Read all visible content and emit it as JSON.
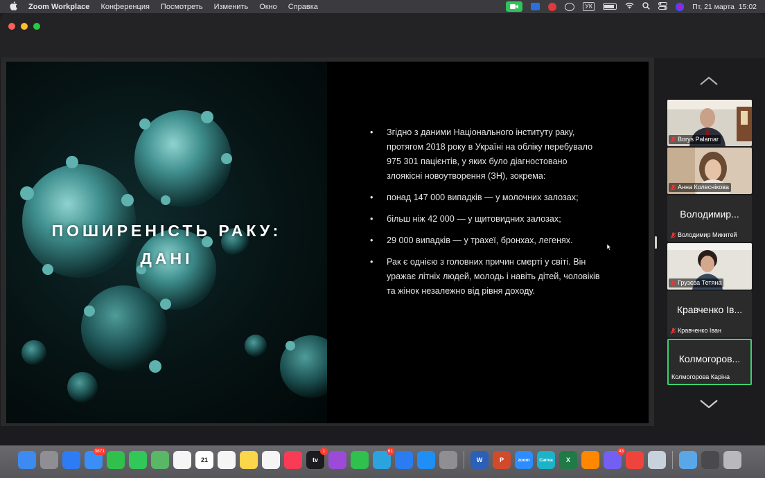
{
  "menubar": {
    "app_name": "Zoom Workplace",
    "menus": [
      "Конференция",
      "Посмотреть",
      "Изменить",
      "Окно",
      "Справка"
    ],
    "keyboard_layout": "УК",
    "datetime": "Пт, 21 марта  15:02"
  },
  "slide": {
    "title_line1": "ПОШИРЕНІСТЬ РАКУ:",
    "title_line2": "ДАНІ",
    "bullets": [
      "Згідно з даними Національного інституту раку, протягом 2018 року в Україні на обліку перебувало 975 301 пацієнтів, у яких було діагностовано злоякісні новоутворення (ЗН), зокрема:",
      "понад 147 000 випадків — у молочних залозах;",
      "більш ніж 42 000 — у щитовидних залозах;",
      "29 000 випадків — у трахеї, бронхах, легенях.",
      "Рак є однією з головних причин смерті у світі. Він уражає літніх людей, молодь і навіть дітей, чоловіків та жінок незалежно від рівня доходу."
    ]
  },
  "participants": [
    {
      "name": "Borys Palamar",
      "display": "",
      "video": true,
      "active": false
    },
    {
      "name": "Анна Колеснікова",
      "display": "",
      "video": true,
      "active": false
    },
    {
      "name": "Володимир Микитей",
      "display": "Володимир...",
      "video": false,
      "active": false
    },
    {
      "name": "Грузєва Тетяна",
      "display": "",
      "video": true,
      "active": false
    },
    {
      "name": "Кравченко Іван",
      "display": "Кравченко Ів...",
      "video": false,
      "active": false
    },
    {
      "name": "Колмогорова Каріна",
      "display": "Колмогоров...",
      "video": false,
      "active": true
    }
  ],
  "dock": {
    "apps": [
      {
        "name": "finder",
        "color": "#3d8bf0",
        "label": ""
      },
      {
        "name": "launchpad",
        "color": "#8e8e93",
        "label": ""
      },
      {
        "name": "safari",
        "color": "#2d7cf6",
        "label": ""
      },
      {
        "name": "mail",
        "color": "#3a8ef5",
        "label": "",
        "badge": "3871"
      },
      {
        "name": "facetime",
        "color": "#30c14d",
        "label": ""
      },
      {
        "name": "messages",
        "color": "#32c759",
        "label": ""
      },
      {
        "name": "maps",
        "color": "#58b865",
        "label": ""
      },
      {
        "name": "photos",
        "color": "#f5f5f5",
        "label": ""
      },
      {
        "name": "calendar",
        "color": "#ffffff",
        "label": "21"
      },
      {
        "name": "reminders",
        "color": "#f5f5f5",
        "label": ""
      },
      {
        "name": "notes",
        "color": "#fbd54a",
        "label": ""
      },
      {
        "name": "freeform",
        "color": "#f5f5f5",
        "label": ""
      },
      {
        "name": "music",
        "color": "#fa3b55",
        "label": ""
      },
      {
        "name": "apple-tv",
        "color": "#1c1c1e",
        "label": "tv",
        "badge": "1"
      },
      {
        "name": "podcasts",
        "color": "#9b4bd8",
        "label": ""
      },
      {
        "name": "numbers",
        "color": "#2fc04d",
        "label": ""
      },
      {
        "name": "telegram",
        "color": "#2aa3de",
        "label": "",
        "badge": "61"
      },
      {
        "name": "keynote",
        "color": "#2a7cf0",
        "label": ""
      },
      {
        "name": "app-store",
        "color": "#1f8ef5",
        "label": ""
      },
      {
        "name": "system-settings",
        "color": "#8e8e93",
        "label": ""
      },
      {
        "name": "word",
        "color": "#2b5fb8",
        "label": "W"
      },
      {
        "name": "powerpoint",
        "color": "#d14a2c",
        "label": "P"
      },
      {
        "name": "zoom",
        "color": "#2d8cff",
        "label": "zoom"
      },
      {
        "name": "canva",
        "color": "#1bb3c8",
        "label": "Canva"
      },
      {
        "name": "excel",
        "color": "#1f7a45",
        "label": "X"
      },
      {
        "name": "vlc",
        "color": "#ff8800",
        "label": ""
      },
      {
        "name": "viber",
        "color": "#7360f2",
        "label": "",
        "badge": "43"
      },
      {
        "name": "anydesk",
        "color": "#ef443b",
        "label": ""
      },
      {
        "name": "preview",
        "color": "#c8d2dc",
        "label": ""
      },
      {
        "name": "downloads-folder",
        "color": "#5aa7e8",
        "label": ""
      },
      {
        "name": "desktop-stack",
        "color": "#4a4a4c",
        "label": ""
      },
      {
        "name": "trash",
        "color": "#b9b9bd",
        "label": ""
      }
    ]
  },
  "colors": {
    "active_speaker": "#3bd16f",
    "zoom_indicator": "#2fc35b"
  }
}
